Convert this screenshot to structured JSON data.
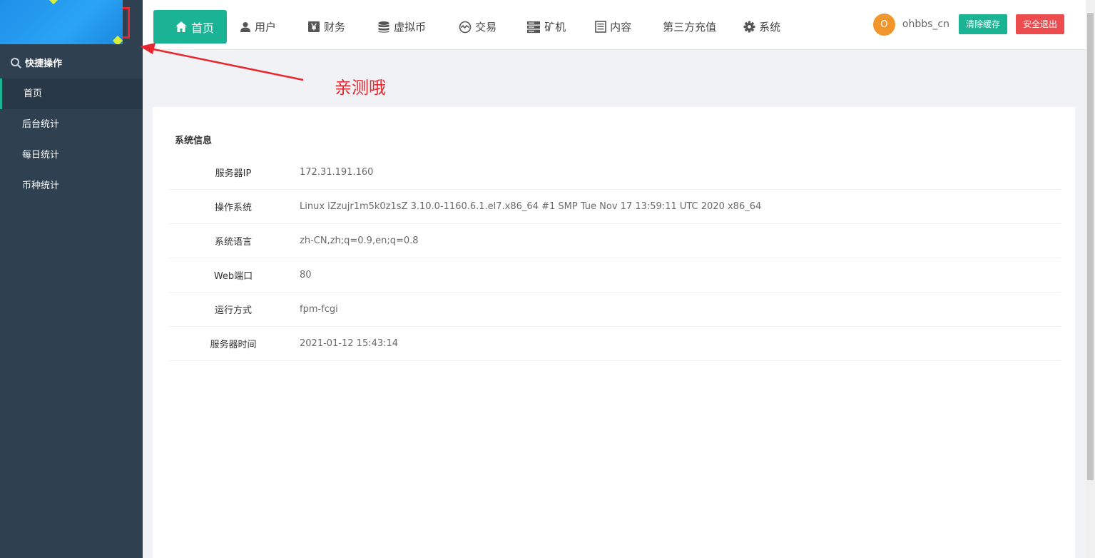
{
  "sidebar": {
    "quick_label": "快捷操作",
    "items": [
      {
        "label": "首页",
        "active": true
      },
      {
        "label": "后台统计",
        "active": false
      },
      {
        "label": "每日统计",
        "active": false
      },
      {
        "label": "币种统计",
        "active": false
      }
    ]
  },
  "topnav": {
    "items": [
      {
        "label": "首页",
        "icon": "home-icon"
      },
      {
        "label": "用户",
        "icon": "user-icon"
      },
      {
        "label": "财务",
        "icon": "yen-icon"
      },
      {
        "label": "虚拟币",
        "icon": "database-icon"
      },
      {
        "label": "交易",
        "icon": "exchange-icon"
      },
      {
        "label": "矿机",
        "icon": "server-icon"
      },
      {
        "label": "内容",
        "icon": "list-icon"
      },
      {
        "label": "第三方充值",
        "icon": ""
      },
      {
        "label": "系统",
        "icon": "gear-icon"
      }
    ],
    "avatar_letter": "O",
    "username": "ohbbs_cn",
    "clear_cache": "清除缓存",
    "logout": "安全退出"
  },
  "annotation": "亲测哦",
  "panel": {
    "title": "系统信息",
    "rows": [
      {
        "key": "服务器IP",
        "value": "172.31.191.160"
      },
      {
        "key": "操作系统",
        "value": "Linux iZzujr1m5k0z1sZ 3.10.0-1160.6.1.el7.x86_64 #1 SMP Tue Nov 17 13:59:11 UTC 2020 x86_64"
      },
      {
        "key": "系统语言",
        "value": "zh-CN,zh;q=0.9,en;q=0.8"
      },
      {
        "key": "Web端口",
        "value": "80"
      },
      {
        "key": "运行方式",
        "value": "fpm-fcgi"
      },
      {
        "key": "服务器时间",
        "value": "2021-01-12 15:43:14"
      }
    ]
  },
  "colors": {
    "sidebar_bg": "#2f4050",
    "accent": "#1ab394",
    "danger": "#ed4c4f",
    "annotation": "#e8262d"
  }
}
